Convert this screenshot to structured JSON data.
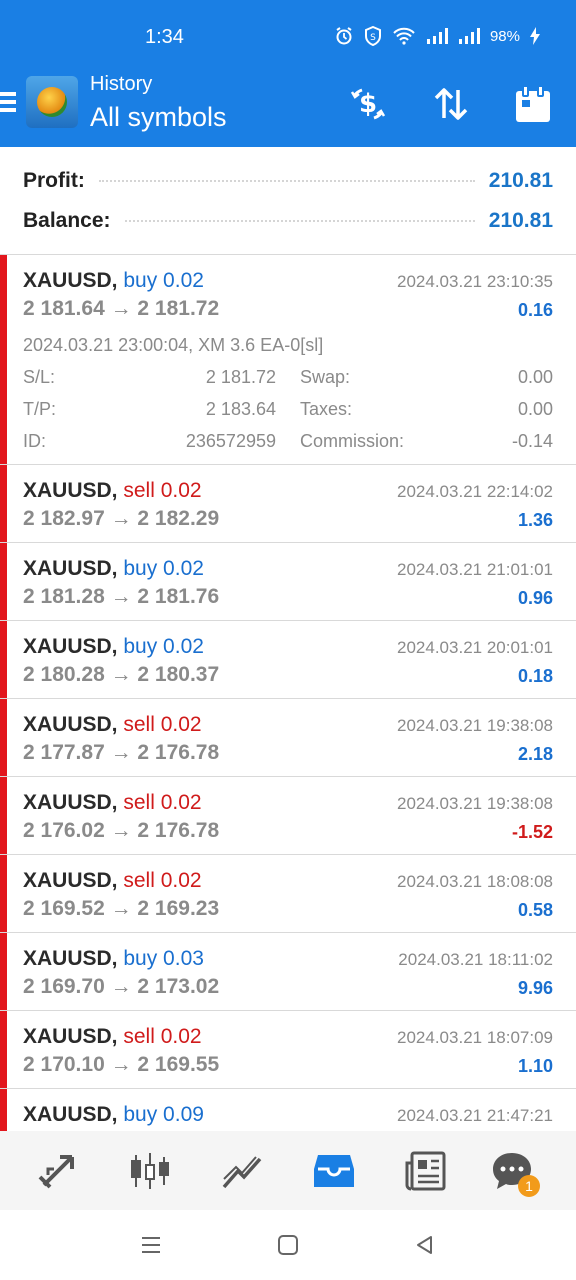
{
  "status": {
    "time": "1:34",
    "battery": "98%"
  },
  "header": {
    "subtitle": "History",
    "title": "All symbols"
  },
  "toolbar_icons": [
    "dollar-refresh-icon",
    "sort-icon",
    "calendar-icon"
  ],
  "summary": {
    "profit_label": "Profit:",
    "profit_value": "210.81",
    "balance_label": "Balance:",
    "balance_value": "210.81"
  },
  "expanded_deal": {
    "symbol": "XAUUSD,",
    "direction": "buy",
    "volume": "buy 0.02",
    "time": "2024.03.21 23:10:35",
    "price": "2 181.64 → 2 181.72",
    "profit": "0.16",
    "comment": "2024.03.21 23:00:04, XM 3.6 EA-0[sl]",
    "sl_label": "S/L:",
    "sl_value": "2 181.72",
    "swap_label": "Swap:",
    "swap_value": "0.00",
    "tp_label": "T/P:",
    "tp_value": "2 183.64",
    "taxes_label": "Taxes:",
    "taxes_value": "0.00",
    "id_label": "ID:",
    "id_value": "236572959",
    "commission_label": "Commission:",
    "commission_value": "-0.14"
  },
  "deals": [
    {
      "symbol": "XAUUSD,",
      "dir": "sell",
      "label": "sell 0.02",
      "time": "2024.03.21 22:14:02",
      "price": "2 182.97 → 2 182.29",
      "profit": "1.36",
      "sign": "pos"
    },
    {
      "symbol": "XAUUSD,",
      "dir": "buy",
      "label": "buy 0.02",
      "time": "2024.03.21 21:01:01",
      "price": "2 181.28 → 2 181.76",
      "profit": "0.96",
      "sign": "pos"
    },
    {
      "symbol": "XAUUSD,",
      "dir": "buy",
      "label": "buy 0.02",
      "time": "2024.03.21 20:01:01",
      "price": "2 180.28 → 2 180.37",
      "profit": "0.18",
      "sign": "pos"
    },
    {
      "symbol": "XAUUSD,",
      "dir": "sell",
      "label": "sell 0.02",
      "time": "2024.03.21 19:38:08",
      "price": "2 177.87 → 2 176.78",
      "profit": "2.18",
      "sign": "pos"
    },
    {
      "symbol": "XAUUSD,",
      "dir": "sell",
      "label": "sell 0.02",
      "time": "2024.03.21 19:38:08",
      "price": "2 176.02 → 2 176.78",
      "profit": "-1.52",
      "sign": "neg"
    },
    {
      "symbol": "XAUUSD,",
      "dir": "sell",
      "label": "sell 0.02",
      "time": "2024.03.21 18:08:08",
      "price": "2 169.52 → 2 169.23",
      "profit": "0.58",
      "sign": "pos"
    },
    {
      "symbol": "XAUUSD,",
      "dir": "buy",
      "label": "buy 0.03",
      "time": "2024.03.21 18:11:02",
      "price": "2 169.70 → 2 173.02",
      "profit": "9.96",
      "sign": "pos"
    },
    {
      "symbol": "XAUUSD,",
      "dir": "sell",
      "label": "sell 0.02",
      "time": "2024.03.21 18:07:09",
      "price": "2 170.10 → 2 169.55",
      "profit": "1.10",
      "sign": "pos"
    },
    {
      "symbol": "XAUUSD,",
      "dir": "buy",
      "label": "buy 0.09",
      "time": "2024.03.21 21:47:21",
      "price": "",
      "profit": "",
      "sign": "pos"
    }
  ],
  "bottom_nav": {
    "items": [
      "trade-arrows-icon",
      "candles-icon",
      "chart-line-icon",
      "history-inbox-icon",
      "news-icon",
      "chat-icon"
    ],
    "active": "history-inbox-icon",
    "chat_badge": "1"
  },
  "colors": {
    "accent": "#1a7fe4",
    "buy": "#1a6fcf",
    "sell": "#d01b1b",
    "row_bar": "#e2161d",
    "badge": "#f29b1b"
  }
}
